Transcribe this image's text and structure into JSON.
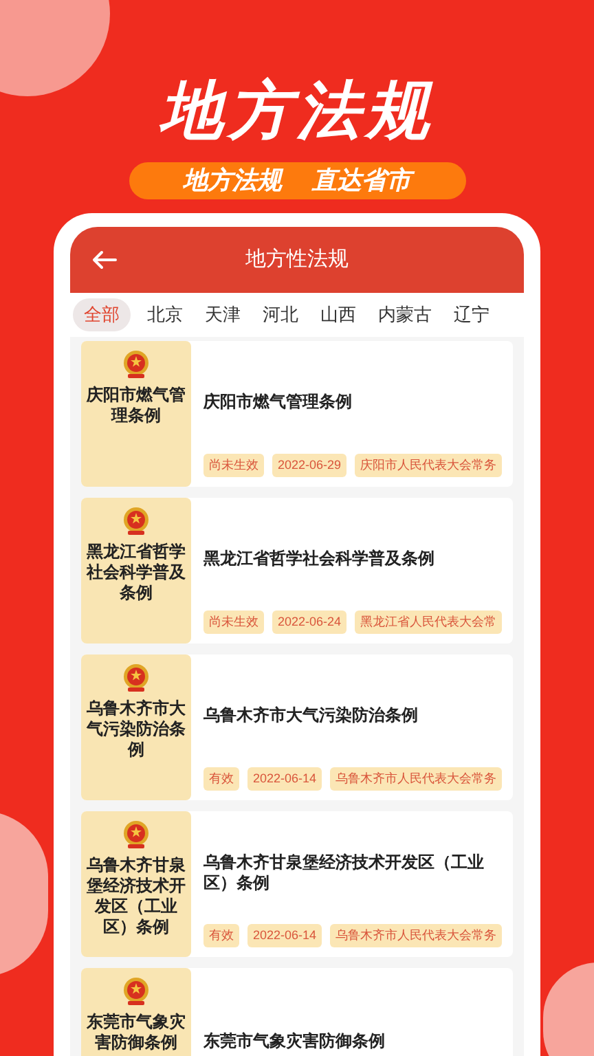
{
  "banner": {
    "headline": "地方法规",
    "slogan_left": "地方法规",
    "slogan_right": "直达省市"
  },
  "header": {
    "title": "地方性法规"
  },
  "tabs": [
    {
      "label": "全部",
      "selected": true
    },
    {
      "label": "北京",
      "selected": false
    },
    {
      "label": "天津",
      "selected": false
    },
    {
      "label": "河北",
      "selected": false
    },
    {
      "label": "山西",
      "selected": false
    },
    {
      "label": "内蒙古",
      "selected": false
    },
    {
      "label": "辽宁",
      "selected": false
    }
  ],
  "laws": [
    {
      "cover_title": "庆阳市燃气管理条例",
      "title": "庆阳市燃气管理条例",
      "tags": [
        "尚未生效",
        "2022-06-29",
        "庆阳市人民代表大会常务"
      ]
    },
    {
      "cover_title": "黑龙江省哲学社会科学普及条例",
      "title": "黑龙江省哲学社会科学普及条例",
      "tags": [
        "尚未生效",
        "2022-06-24",
        "黑龙江省人民代表大会常"
      ]
    },
    {
      "cover_title": "乌鲁木齐市大气污染防治条例",
      "title": "乌鲁木齐市大气污染防治条例",
      "tags": [
        "有效",
        "2022-06-14",
        "乌鲁木齐市人民代表大会常务"
      ]
    },
    {
      "cover_title": "乌鲁木齐甘泉堡经济技术开发区（工业区）条例",
      "title": "乌鲁木齐甘泉堡经济技术开发区（工业区）条例",
      "tags": [
        "有效",
        "2022-06-14",
        "乌鲁木齐市人民代表大会常务"
      ]
    },
    {
      "cover_title": "东莞市气象灾害防御条例",
      "title": "东莞市气象灾害防御条例"
    }
  ]
}
